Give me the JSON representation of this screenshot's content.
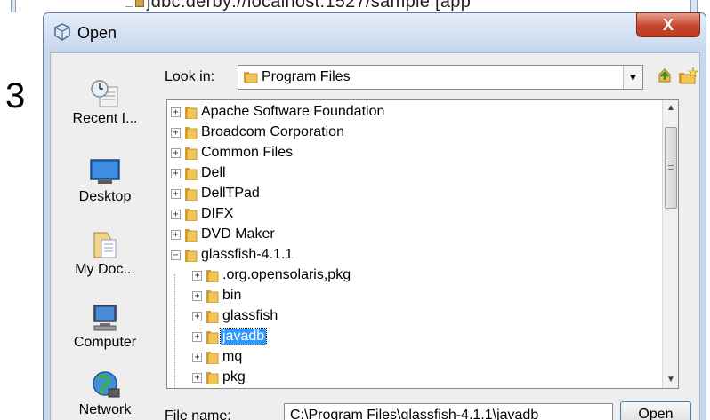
{
  "background": {
    "path_text": "jdbc:derby://localhost:1527/sample [app"
  },
  "step_number": "3",
  "dialog": {
    "title": "Open",
    "close_label": "X"
  },
  "places": [
    {
      "label": "Recent I...",
      "icon": "recent-items-icon"
    },
    {
      "label": "Desktop",
      "icon": "desktop-icon"
    },
    {
      "label": "My Doc...",
      "icon": "my-documents-icon"
    },
    {
      "label": "Computer",
      "icon": "computer-icon"
    },
    {
      "label": "Network",
      "icon": "network-icon"
    }
  ],
  "look_in": {
    "label": "Look in:",
    "value": "Program Files"
  },
  "file_list": {
    "items": [
      {
        "name": "Apache Software Foundation",
        "expander": "+"
      },
      {
        "name": "Broadcom Corporation",
        "expander": "+"
      },
      {
        "name": "Common Files",
        "expander": "+"
      },
      {
        "name": "Dell",
        "expander": "+"
      },
      {
        "name": "DellTPad",
        "expander": "+"
      },
      {
        "name": "DIFX",
        "expander": "+"
      },
      {
        "name": "DVD Maker",
        "expander": "+"
      },
      {
        "name": "glassfish-4.1.1",
        "expander": "−"
      },
      {
        "name": ".org.opensolaris,pkg",
        "expander": "+"
      },
      {
        "name": "bin",
        "expander": "+"
      },
      {
        "name": "glassfish",
        "expander": "+"
      },
      {
        "name": "javadb",
        "expander": "+",
        "selected": true
      },
      {
        "name": "mq",
        "expander": "+"
      },
      {
        "name": "pkg",
        "expander": "+"
      }
    ]
  },
  "file_name": {
    "label": "File name:",
    "value": "C:\\Program Files\\glassfish-4.1.1\\javadb"
  },
  "buttons": {
    "open_label": "Open"
  }
}
